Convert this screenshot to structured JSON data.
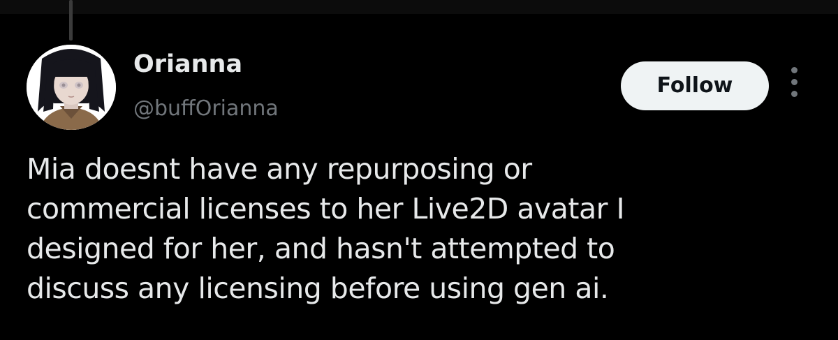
{
  "tweet": {
    "author": {
      "display_name": "Orianna",
      "handle": "@buffOrianna"
    },
    "follow_label": "Follow",
    "more_icon": "more-vertical-icon",
    "text_lines": [
      "Mia doesnt have any repurposing or",
      "commercial licenses to her Live2D avatar I",
      "designed for her, and hasn't attempted to",
      "discuss any licensing before using gen ai."
    ]
  },
  "colors": {
    "background": "#000000",
    "primary_text": "#e7e9ea",
    "secondary_text": "#71767b",
    "follow_button_bg": "#eff3f4",
    "follow_button_text": "#0f1419",
    "thread_line": "#3b3b3b"
  }
}
